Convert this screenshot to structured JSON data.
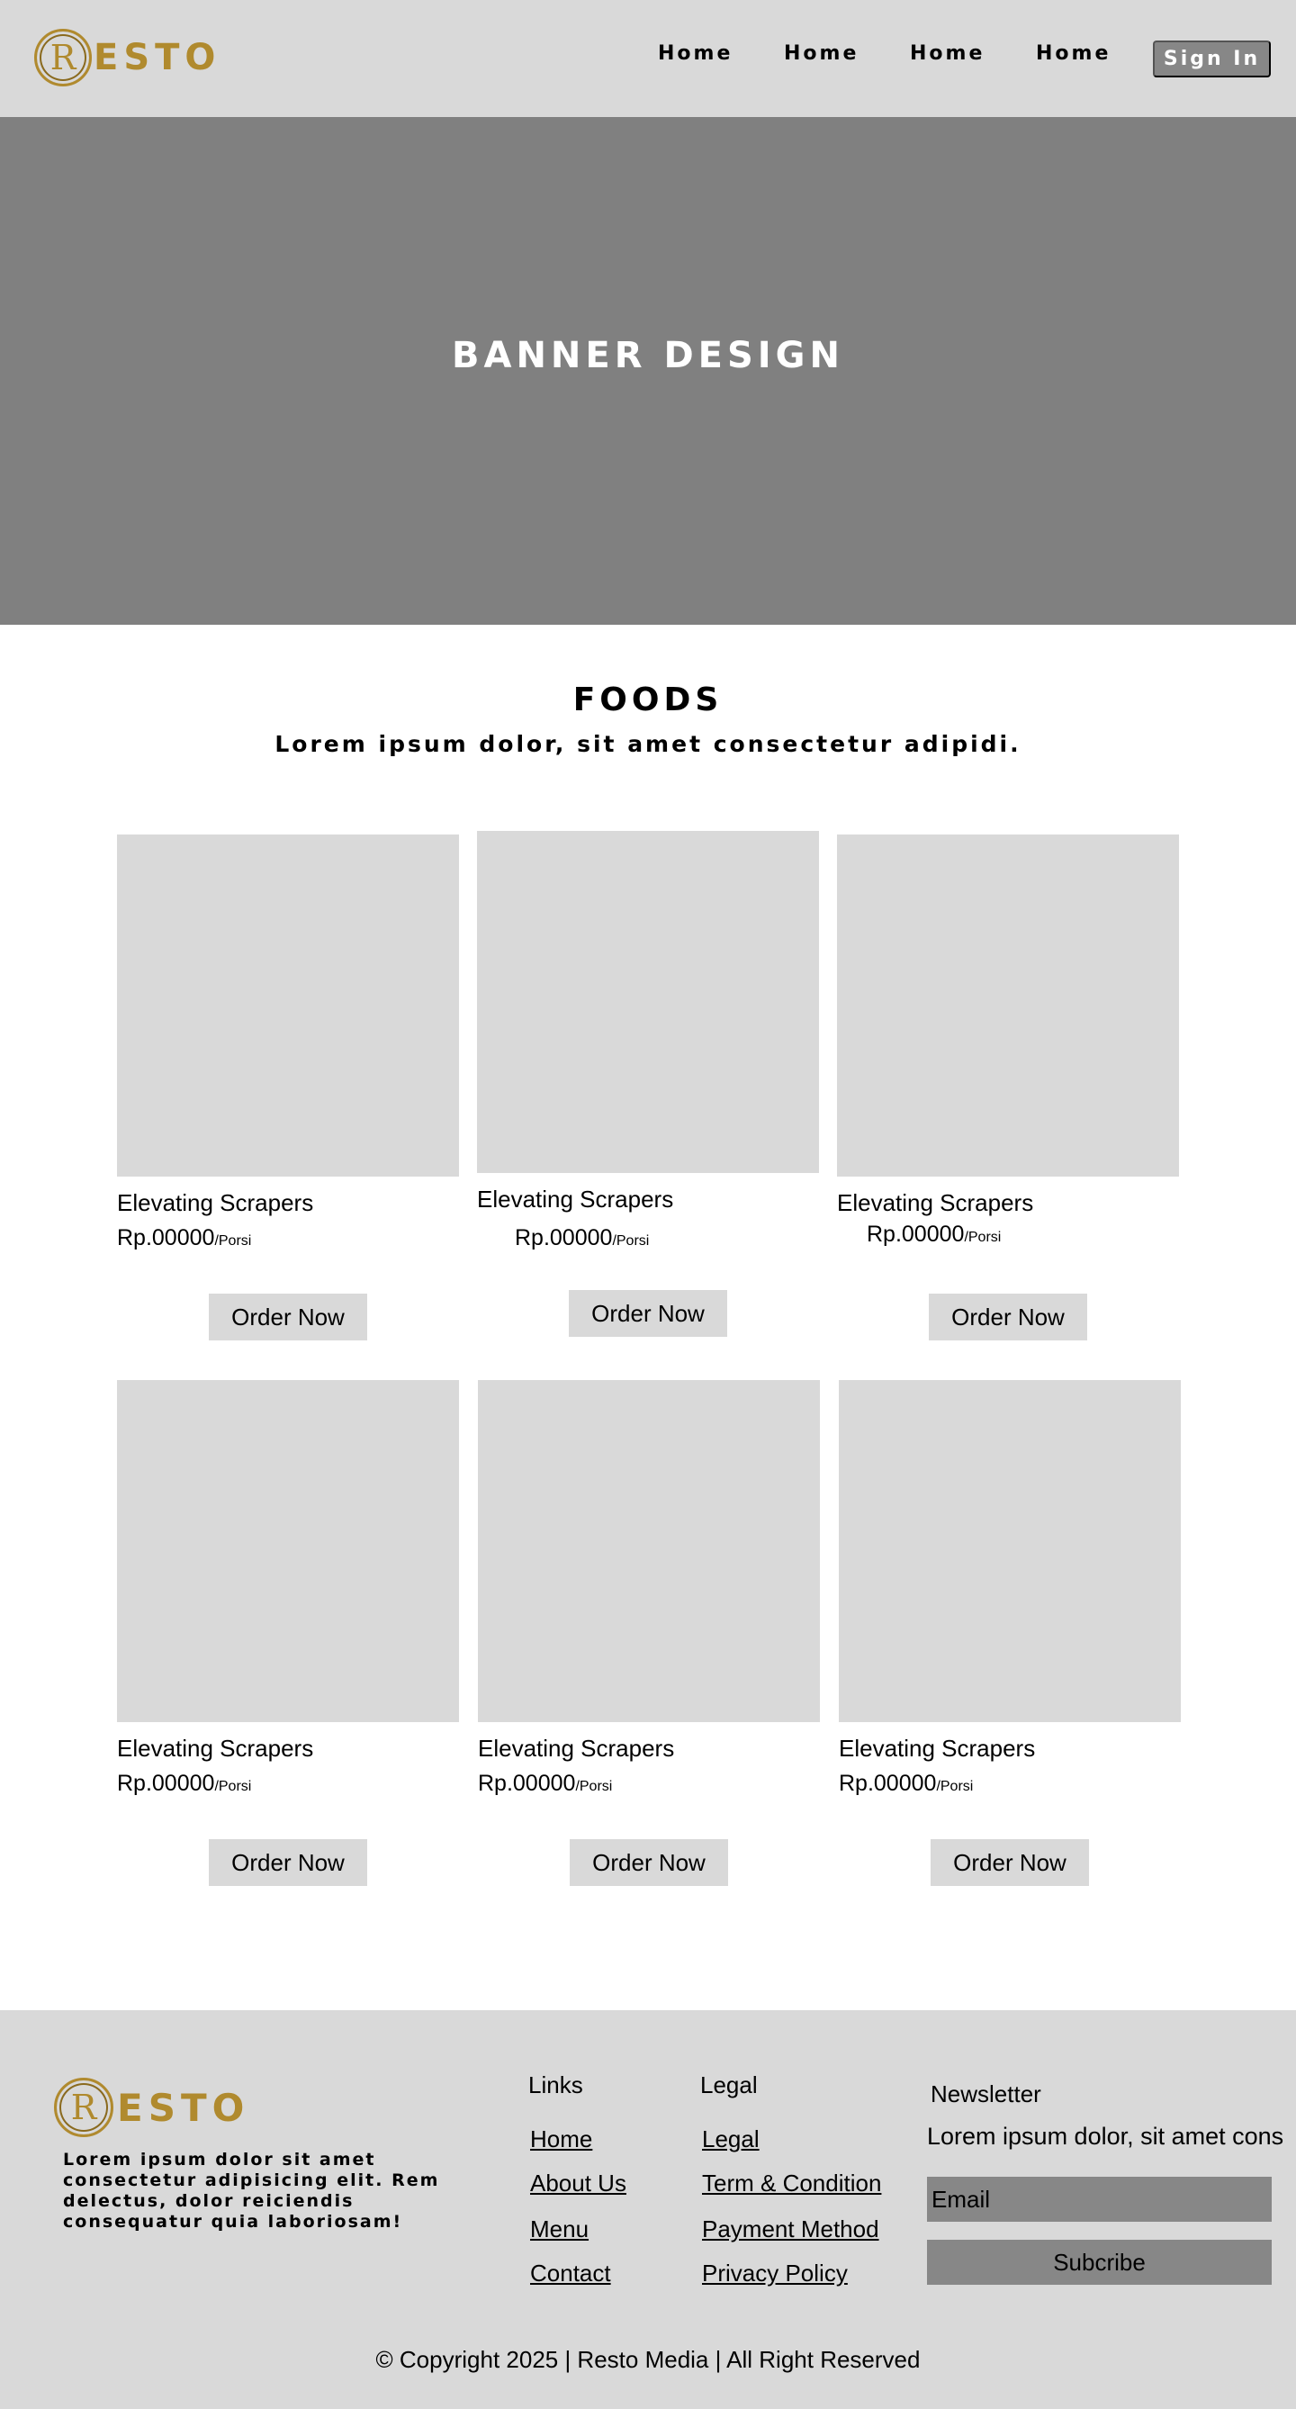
{
  "brand": {
    "logo_letter": "R",
    "logo_word": "ESTO",
    "color": "#b08a2e"
  },
  "nav": {
    "items": [
      "Home",
      "Home",
      "Home",
      "Home"
    ],
    "signin_label": "Sign In"
  },
  "banner": {
    "title": "BANNER DESIGN"
  },
  "foods": {
    "title": "FOODS",
    "subtitle": "Lorem ipsum dolor, sit amet consectetur adipidi.",
    "cards": [
      {
        "name": "Elevating Scrapers",
        "price": "Rp.00000",
        "unit": "/Porsi",
        "button": "Order Now"
      },
      {
        "name": "Elevating Scrapers",
        "price": "Rp.00000",
        "unit": "/Porsi",
        "button": "Order Now"
      },
      {
        "name": "Elevating Scrapers",
        "price": "Rp.00000",
        "unit": "/Porsi",
        "button": "Order Now"
      },
      {
        "name": "Elevating Scrapers",
        "price": "Rp.00000",
        "unit": "/Porsi",
        "button": "Order Now"
      },
      {
        "name": "Elevating Scrapers",
        "price": "Rp.00000",
        "unit": "/Porsi",
        "button": "Order Now"
      },
      {
        "name": "Elevating Scrapers",
        "price": "Rp.00000",
        "unit": "/Porsi",
        "button": "Order Now"
      }
    ]
  },
  "footer": {
    "description": "Lorem ipsum dolor sit amet consectetur adipisicing elit. Rem delectus, dolor reiciendis consequatur quia laboriosam!",
    "links": {
      "heading": "Links",
      "items": [
        "Home",
        "About Us",
        "Menu",
        "Contact"
      ]
    },
    "legal": {
      "heading": "Legal",
      "items": [
        "Legal",
        "Term & Condition",
        "Payment Method",
        "Privacy Policy"
      ]
    },
    "newsletter": {
      "heading": "Newsletter",
      "text": "Lorem ipsum dolor, sit amet cons",
      "email_placeholder": "Email",
      "button": "Subcribe"
    },
    "copyright": "© Copyright 2025 | Resto Media | All Right Reserved"
  }
}
